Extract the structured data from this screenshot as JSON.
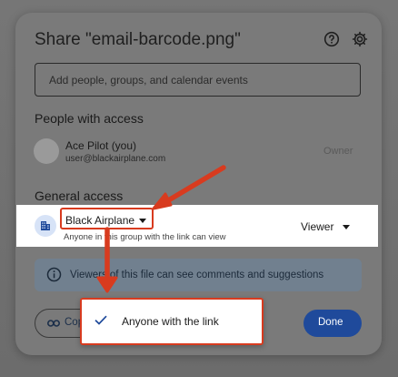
{
  "dialog": {
    "title": "Share \"email-barcode.png\"",
    "help_icon": "help-circle-icon",
    "settings_icon": "gear-icon"
  },
  "add_people": {
    "placeholder": "Add people, groups, and calendar events"
  },
  "people_section": {
    "title": "People with access",
    "person": {
      "name": "Ace Pilot (you)",
      "email": "user@blackairplane.com",
      "role": "Owner"
    }
  },
  "general_access": {
    "title": "General access",
    "group": "Black Airplane",
    "description": "Anyone in this group with the link can view",
    "role": "Viewer"
  },
  "info_banner": {
    "text": "Viewers of this file can see comments and suggestions"
  },
  "footer": {
    "copy_label": "Copy link",
    "done_label": "Done"
  },
  "menu": {
    "selected_item": "Anyone with the link"
  },
  "colors": {
    "annotation_red": "#d83b1f",
    "primary_blue": "#1f4a9b"
  }
}
